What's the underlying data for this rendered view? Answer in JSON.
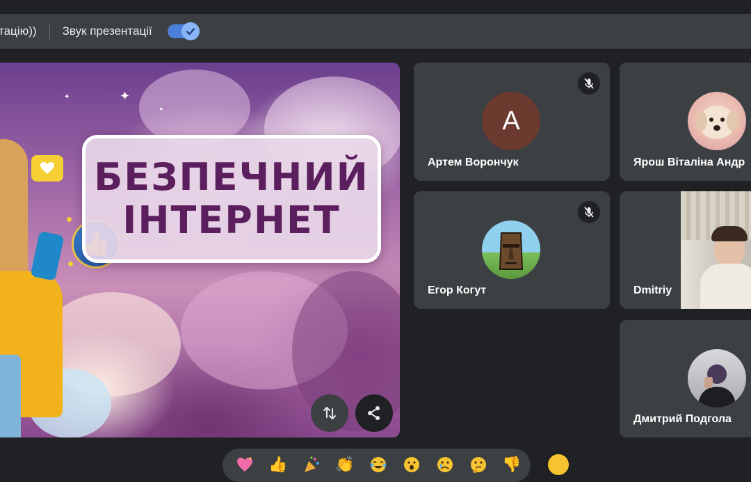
{
  "toolbar": {
    "truncated_text": "тацію))",
    "sound_label": "Звук презентації",
    "sound_toggle_on": true
  },
  "presentation": {
    "title_line1": "БЕЗПЕЧНИЙ",
    "title_line2": "ІНТЕРНЕТ"
  },
  "participants": [
    {
      "name": "Артем Ворончук",
      "avatar": "letter",
      "letter": "A",
      "muted": true
    },
    {
      "name": "Ярош Віталіна Андр",
      "avatar": "puppy-photo",
      "muted": false
    },
    {
      "name": "Егор Когут",
      "avatar": "moai-photo",
      "muted": true
    },
    {
      "name": "Dmitriy",
      "avatar": "video",
      "muted": false
    },
    {
      "name": "Дмитрий Подгола",
      "avatar": "person-photo",
      "muted": false
    }
  ],
  "reactions": [
    "sparkling-heart",
    "thumbs-up",
    "party-popper",
    "clapping-hands",
    "tears-of-joy",
    "surprised-face",
    "crying-face",
    "thinking-face",
    "thumbs-down"
  ],
  "colors": {
    "background": "#202124",
    "tile": "#3c4043",
    "accent": "#8ab4f8",
    "title_text": "#5c1f5e"
  }
}
